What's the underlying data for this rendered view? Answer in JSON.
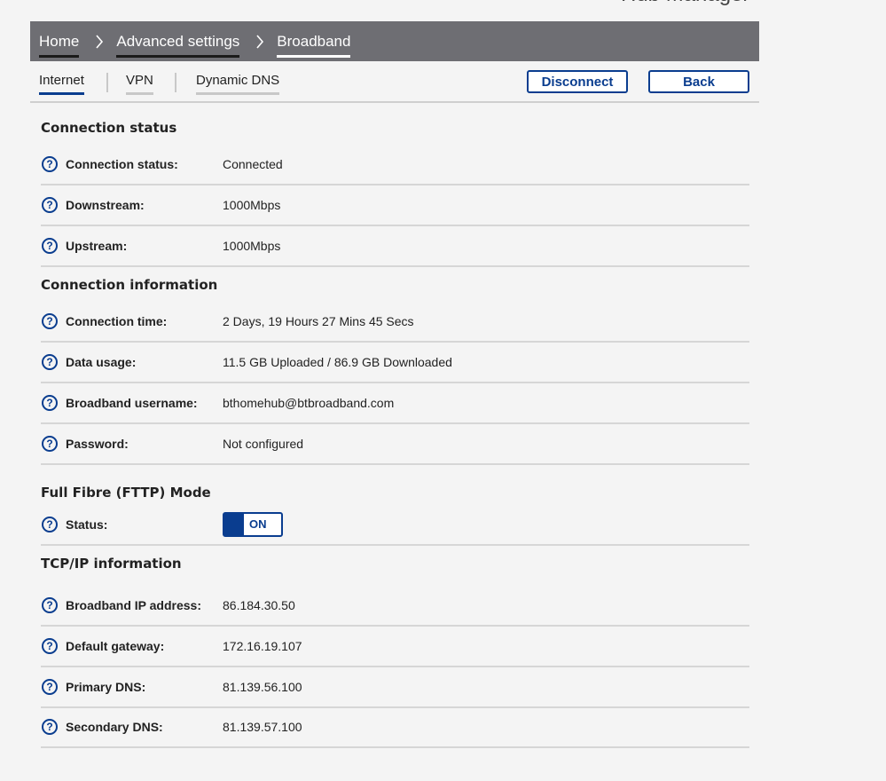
{
  "app": {
    "title": "Hub Manager"
  },
  "breadcrumb": {
    "items": [
      {
        "label": "Home"
      },
      {
        "label": "Advanced settings"
      },
      {
        "label": "Broadband"
      }
    ]
  },
  "tabs": [
    {
      "label": "Internet",
      "active": true
    },
    {
      "label": "VPN",
      "active": false
    },
    {
      "label": "Dynamic DNS",
      "active": false
    }
  ],
  "actions": {
    "disconnect_label": "Disconnect",
    "back_label": "Back"
  },
  "sections": {
    "connection_status": {
      "title": "Connection status",
      "rows": [
        {
          "label": "Connection status:",
          "value": "Connected"
        },
        {
          "label": "Downstream:",
          "value": "1000Mbps"
        },
        {
          "label": "Upstream:",
          "value": "1000Mbps"
        }
      ]
    },
    "connection_information": {
      "title": "Connection information",
      "rows": [
        {
          "label": "Connection time:",
          "value": "2 Days, 19 Hours 27 Mins 45 Secs"
        },
        {
          "label": "Data usage:",
          "value": "11.5 GB Uploaded / 86.9 GB Downloaded"
        },
        {
          "label": "Broadband username:",
          "value": "bthomehub@btbroadband.com"
        },
        {
          "label": "Password:",
          "value": "Not configured"
        }
      ]
    },
    "full_fibre": {
      "title": "Full Fibre (FTTP) Mode",
      "status_label": "Status:",
      "toggle_text": "ON"
    },
    "tcpip": {
      "title": "TCP/IP information",
      "rows": [
        {
          "label": "Broadband IP address:",
          "value": "86.184.30.50"
        },
        {
          "label": "Default gateway:",
          "value": "172.16.19.107"
        },
        {
          "label": "Primary DNS:",
          "value": "81.139.56.100"
        },
        {
          "label": "Secondary DNS:",
          "value": "81.139.57.100"
        }
      ]
    }
  },
  "help_icon_glyph": "?",
  "colors": {
    "accent": "#0a3d8f",
    "breadcrumb_bg": "#6e6e73",
    "page_bg": "#f4f4f4"
  }
}
